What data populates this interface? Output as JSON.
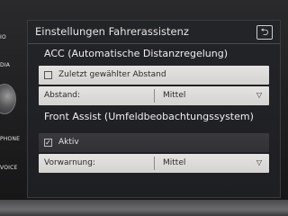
{
  "side_buttons": [
    "IO",
    "DIA",
    "PHONE",
    "VOICE"
  ],
  "header": {
    "title": "Einstellungen Fahrerassistenz",
    "back_symbol": "⮌"
  },
  "acc": {
    "section_title": "ACC (Automatische Distanzregelung)",
    "checkbox_label": "Zuletzt gewählter Abstand",
    "checkbox_checked": false,
    "distance_label": "Abstand:",
    "distance_value": "Mittel"
  },
  "front_assist": {
    "section_title": "Front Assist (Umfeldbeobachtungssystem)",
    "checkbox_label": "Aktiv",
    "checkbox_checked": true,
    "warning_label": "Vorwarnung:",
    "warning_value": "Mittel"
  },
  "icons": {
    "dropdown": "chevron-down-icon",
    "back": "back-arrow-icon",
    "checkmark": "checkmark-icon"
  }
}
